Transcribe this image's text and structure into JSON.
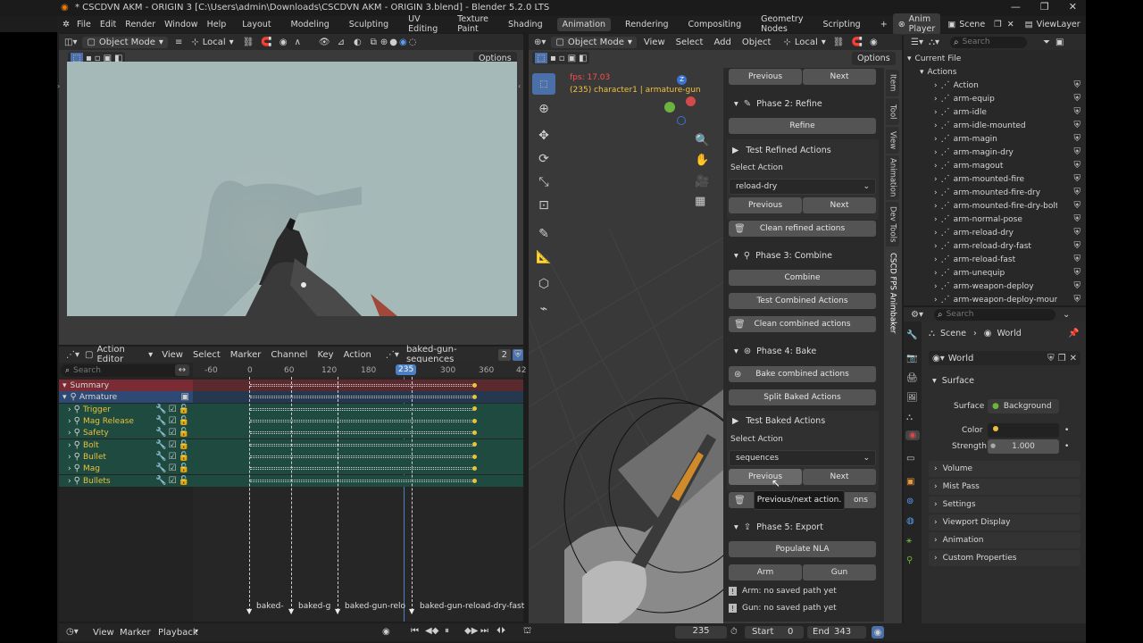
{
  "window": {
    "title": "* CSCDVN AKM - ORIGIN 3 [C:\\Users\\admin\\Downloads\\CSCDVN AKM - ORIGIN 3.blend] - Blender 5.2.0 LTS"
  },
  "menu": {
    "items": [
      "File",
      "Edit",
      "Render",
      "Window",
      "Help"
    ],
    "workspaces": [
      "Layout",
      "Modeling",
      "Sculpting",
      "UV Editing",
      "Texture Paint",
      "Shading",
      "Animation",
      "Rendering",
      "Compositing",
      "Geometry Nodes",
      "Scripting"
    ],
    "active_workspace": "Animation",
    "scene_tab": "Anim Player",
    "scene": "Scene",
    "view_layer": "ViewLayer"
  },
  "viewport1": {
    "mode": "Object Mode",
    "orientation": "Local",
    "options": "Options"
  },
  "action_editor": {
    "editor": "Action Editor",
    "menus": [
      "View",
      "Select",
      "Marker",
      "Channel",
      "Key",
      "Action"
    ],
    "action": "baked-gun-sequences",
    "users": "2",
    "search_placeholder": "Search",
    "ruler": [
      "-60",
      "0",
      "60",
      "120",
      "180",
      "235",
      "300",
      "360",
      "42"
    ],
    "current_frame": "235",
    "channels": [
      "Summary",
      "Armature",
      "Trigger",
      "Mag Release",
      "Safety",
      "Bolt",
      "Bullet",
      "Mag",
      "Bullets"
    ],
    "markers": [
      "baked-",
      "baked-g",
      "baked-gun-relo",
      "baked-gun-reload-dry-fast"
    ]
  },
  "timeline": {
    "menus": [
      "View",
      "Marker",
      "Playback"
    ],
    "frame": "235",
    "start_label": "Start",
    "start": "0",
    "end_label": "End",
    "end": "343"
  },
  "viewport2": {
    "mode": "Object Mode",
    "menus": [
      "View",
      "Select",
      "Add",
      "Object"
    ],
    "orientation": "Local",
    "options": "Options",
    "fps": "fps: 17.03",
    "info": "(235) character1 | armature-gun",
    "tooltip": "Previous/next action."
  },
  "npanel": {
    "top_prev": "Previous",
    "top_next": "Next",
    "phase2": "Phase 2: Refine",
    "refine": "Refine",
    "test_refined": "Test Refined Actions",
    "select_action": "Select Action",
    "refined_value": "reload-dry",
    "prev": "Previous",
    "next": "Next",
    "clean_refined": "Clean refined actions",
    "phase3": "Phase 3: Combine",
    "combine": "Combine",
    "test_combined": "Test Combined Actions",
    "clean_combined": "Clean combined actions",
    "phase4": "Phase 4: Bake",
    "bake_combined": "Bake combined actions",
    "split_baked": "Split Baked Actions",
    "test_baked": "Test Baked Actions",
    "select_action2": "Select Action",
    "baked_value": "sequences",
    "prev2": "Previous",
    "next2": "Next",
    "clean_baked_tail": "ons",
    "phase5": "Phase 5: Export",
    "populate_nla": "Populate NLA",
    "arm": "Arm",
    "gun": "Gun",
    "arm_path": "Arm: no saved path yet",
    "gun_path": "Gun: no saved path yet",
    "tabs": [
      "Item",
      "Tool",
      "View",
      "Animation",
      "Dev Tools",
      "CSCD FPS Animbaker"
    ]
  },
  "outliner": {
    "search_placeholder": "Search",
    "root": "Current File",
    "group": "Actions",
    "items": [
      "Action",
      "arm-equip",
      "arm-idle",
      "arm-idle-mounted",
      "arm-magin",
      "arm-magin-dry",
      "arm-magout",
      "arm-mounted-fire",
      "arm-mounted-fire-dry",
      "arm-mounted-fire-dry-bolt-lock",
      "arm-normal-pose",
      "arm-reload-dry",
      "arm-reload-dry-fast",
      "arm-reload-fast",
      "arm-unequip",
      "arm-weapon-deploy",
      "arm-weapon-deploy-mounted"
    ]
  },
  "properties": {
    "search_placeholder": "Search",
    "breadcrumb_scene": "Scene",
    "breadcrumb_world": "World",
    "world_name": "World",
    "surface": "Surface",
    "surface_label": "Surface",
    "surface_value": "Background",
    "color_label": "Color",
    "strength_label": "Strength",
    "strength_value": "1.000",
    "panels": [
      "Volume",
      "Mist Pass",
      "Settings",
      "Viewport Display",
      "Animation",
      "Custom Properties"
    ]
  }
}
